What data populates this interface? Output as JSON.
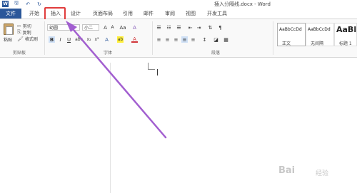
{
  "title_bar": {
    "document_title": "插入分隔线.docx - Word",
    "quick_access": [
      {
        "icon": "word-app-icon"
      },
      {
        "icon": "save-icon",
        "glyph": "🖫"
      },
      {
        "icon": "undo-icon",
        "glyph": "↶"
      },
      {
        "icon": "redo-icon",
        "glyph": "↻"
      }
    ]
  },
  "tabs": [
    {
      "label": "文件",
      "active": false
    },
    {
      "label": "开始",
      "active": false
    },
    {
      "label": "插入",
      "active": true
    },
    {
      "label": "设计",
      "active": false
    },
    {
      "label": "页面布局",
      "active": false
    },
    {
      "label": "引用",
      "active": false
    },
    {
      "label": "邮件",
      "active": false
    },
    {
      "label": "审阅",
      "active": false
    },
    {
      "label": "视图",
      "active": false
    },
    {
      "label": "开发工具",
      "active": false
    }
  ],
  "clipboard": {
    "paste_label": "粘贴",
    "cut_label": "剪切",
    "copy_label": "复制",
    "format_painter_label": "格式刷",
    "group_label": "剪贴板"
  },
  "font": {
    "font_name": "幼圆",
    "font_size": "小二",
    "group_label": "字体",
    "buttons": {
      "bold": "B",
      "italic": "I",
      "underline": "U",
      "grow": "A",
      "shrink": "A",
      "change_case": "Aa",
      "highlight": "ab",
      "font_color": "A",
      "clear_format": "A"
    }
  },
  "paragraph": {
    "group_label": "段落"
  },
  "styles": [
    {
      "sample": "AaBbCcDd",
      "name": "正文",
      "selected": true
    },
    {
      "sample": "AaBbCcDd",
      "name": "无间隔",
      "selected": false
    },
    {
      "sample": "AaBl",
      "name": "标题 1",
      "selected": false
    }
  ],
  "watermark": {
    "text": "Bai",
    "sub": "经验"
  },
  "colors": {
    "accent": "#2b579a",
    "highlight_border": "#e03c3c",
    "arrow": "#a25fd0"
  }
}
